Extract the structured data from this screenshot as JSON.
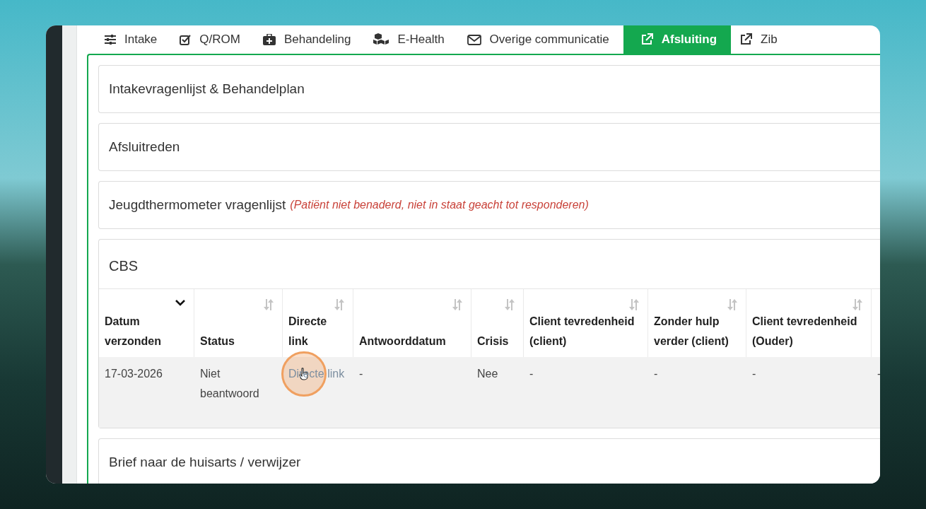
{
  "tabs": [
    {
      "label": "Intake",
      "kind": "sliders",
      "selected": false
    },
    {
      "label": "Q/ROM",
      "kind": "check",
      "selected": false
    },
    {
      "label": "Behandeling",
      "kind": "medkit",
      "selected": false
    },
    {
      "label": "E-Health",
      "kind": "cubes",
      "selected": false
    },
    {
      "label": "Overige communicatie",
      "kind": "envelope",
      "selected": false
    },
    {
      "label": "Afsluiting",
      "kind": "external",
      "selected": true
    },
    {
      "label": "Zib",
      "kind": "external",
      "selected": false
    }
  ],
  "sections": [
    {
      "kind": "panel",
      "title": "Intakevragenlijst & Behandelplan"
    },
    {
      "kind": "panel",
      "title": "Afsluitreden"
    },
    {
      "kind": "panel",
      "title": "Jeugdthermometer vragenlijst",
      "note": "(Patiënt niet benaderd, niet in staat geacht tot responderen)"
    },
    {
      "kind": "table",
      "title": "CBS",
      "columns": [
        {
          "label": "Datum verzonden",
          "sorted": true
        },
        {
          "label": "Status",
          "sorted": false
        },
        {
          "label": "Directe link",
          "sorted": false
        },
        {
          "label": "Antwoorddatum",
          "sorted": false
        },
        {
          "label": "Crisis",
          "sorted": false
        },
        {
          "label": "Client tevredenheid (client)",
          "sorted": false
        },
        {
          "label": "Zonder hulp verder (client)",
          "sorted": false
        },
        {
          "label": "Client tevredenheid (Ouder)",
          "sorted": false
        },
        {}
      ],
      "rows": [
        {
          "cells": [
            {
              "kind": "text",
              "text": "17-03-2026"
            },
            {
              "kind": "text",
              "text": "Niet beantwoord"
            },
            {
              "kind": "link",
              "text": "Directe link"
            },
            {
              "kind": "text",
              "text": "-"
            },
            {
              "kind": "text",
              "text": "Nee"
            },
            {
              "kind": "text",
              "text": "-"
            },
            {
              "kind": "text",
              "text": "-"
            },
            {
              "kind": "text",
              "text": "-"
            },
            {
              "kind": "text",
              "text": "-"
            }
          ]
        }
      ]
    },
    {
      "kind": "panel",
      "title": "Brief naar de huisarts / verwijzer"
    }
  ]
}
